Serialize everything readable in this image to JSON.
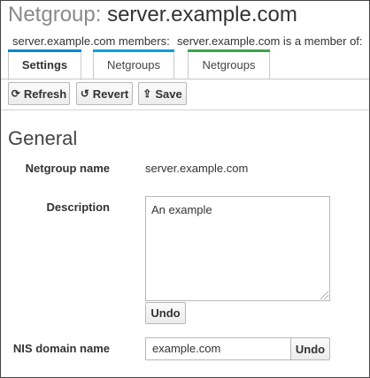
{
  "header": {
    "prefix": "Netgroup:",
    "name": "server.example.com"
  },
  "subheads": {
    "members": "server.example.com members:",
    "member_of": "server.example.com is a member of:"
  },
  "tabs": [
    {
      "label": "Settings",
      "active": true,
      "color": "#0088ce"
    },
    {
      "label": "Netgroups",
      "active": false,
      "color": "#00a0e0"
    },
    {
      "label": "Netgroups",
      "active": false,
      "color": "#3aa54a"
    }
  ],
  "toolbar": {
    "refresh": "Refresh",
    "revert": "Revert",
    "save": "Save"
  },
  "section_title": "General",
  "fields": {
    "netgroup_name_label": "Netgroup name",
    "netgroup_name_value": "server.example.com",
    "description_label": "Description",
    "description_value": "An example",
    "description_undo": "Undo",
    "nis_label": "NIS domain name",
    "nis_value": "example.com",
    "nis_undo": "Undo"
  }
}
